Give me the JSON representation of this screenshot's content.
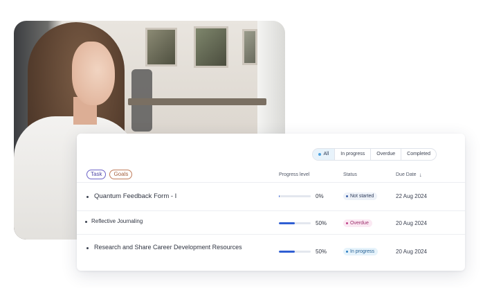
{
  "filters": [
    {
      "label": "All",
      "active": true
    },
    {
      "label": "In progress",
      "active": false
    },
    {
      "label": "Overdue",
      "active": false
    },
    {
      "label": "Completed",
      "active": false
    }
  ],
  "chips": {
    "task": "Task",
    "goals": "Goals"
  },
  "columns": {
    "progress": "Progress level",
    "status": "Status",
    "due": "Due Date"
  },
  "rows": [
    {
      "title": "Quantum Feedback Form - I",
      "progress": 0,
      "progress_label": "0%",
      "status": "Not started",
      "due": "22 Aug 2024"
    },
    {
      "title": "Reflective Journaling",
      "progress": 50,
      "progress_label": "50%",
      "status": "Overdue",
      "due": "20 Aug 2024"
    },
    {
      "title": "Research and Share Career Development Resources",
      "progress": 50,
      "progress_label": "50%",
      "status": "In progress",
      "due": "20 Aug 2024"
    }
  ],
  "colors": {
    "accent": "#2f5ed3",
    "status_not_started_bg": "#eef2f8",
    "status_not_started_dot": "#3b5fa8",
    "status_overdue_bg": "#fbe9f3",
    "status_overdue_dot": "#c0428a",
    "status_in_progress_bg": "#e6f3fb",
    "status_in_progress_dot": "#2e7fc2"
  },
  "icons": {
    "sort": "arrow-down-icon",
    "filter_active": "dot-icon"
  }
}
